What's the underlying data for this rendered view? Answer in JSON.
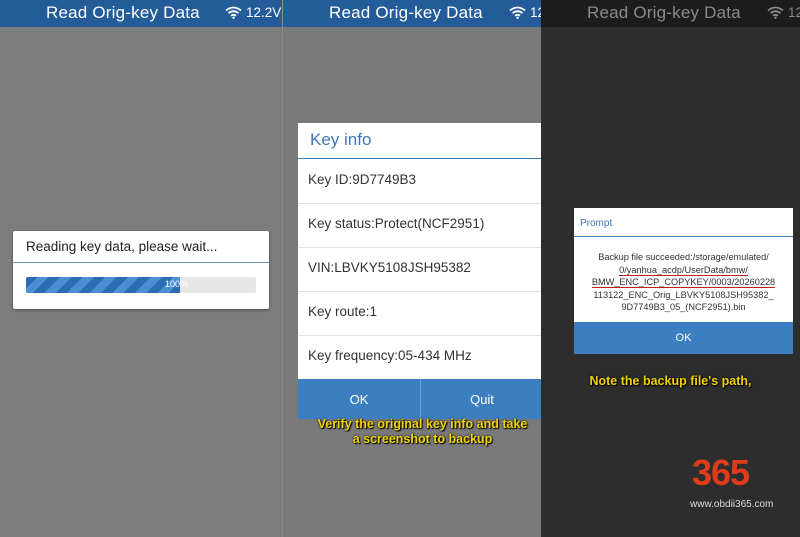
{
  "panels": [
    {
      "title": "Read Orig-key Data",
      "status": "12.2V",
      "dialog": {
        "message": "Reading key data, please wait...",
        "progress": 100,
        "progress_label": "100%"
      }
    },
    {
      "title": "Read Orig-key Data",
      "status": "12",
      "dialog": {
        "title": "Key info",
        "rows": [
          "Key ID:9D7749B3",
          "Key status:Protect(NCF2951)",
          "VIN:LBVKY5108JSH95382",
          "Key route:1",
          "Key frequency:05-434 MHz"
        ],
        "ok_label": "OK",
        "quit_label": "Quit"
      },
      "caption": [
        "Verify the original key info and take",
        "a screenshot to backup"
      ]
    },
    {
      "title": "Read Orig-key Data",
      "status": "12",
      "dialog": {
        "title": "Prompt",
        "message_lines": [
          "Backup file succeeded:/storage/emulated/",
          "0/yanhua_acdp/UserData/bmw/",
          "BMW_ENC_ICP_COPYKEY/0003/20260228",
          "113122_ENC_Orig_LBVKY5108JSH95382_",
          "9D7749B3_05_(NCF2951).bin"
        ],
        "ok_label": "OK"
      },
      "caption": [
        "Note the backup file's path,"
      ]
    }
  ],
  "watermark": {
    "logo_text": "365",
    "url": "www.obdii365.com"
  },
  "colors": {
    "title_bar": "#245c9a",
    "accent": "#3c7fc0",
    "caption": "#f2d300",
    "logo": "#e03c1c"
  },
  "icons": [
    "wifi-icon"
  ]
}
